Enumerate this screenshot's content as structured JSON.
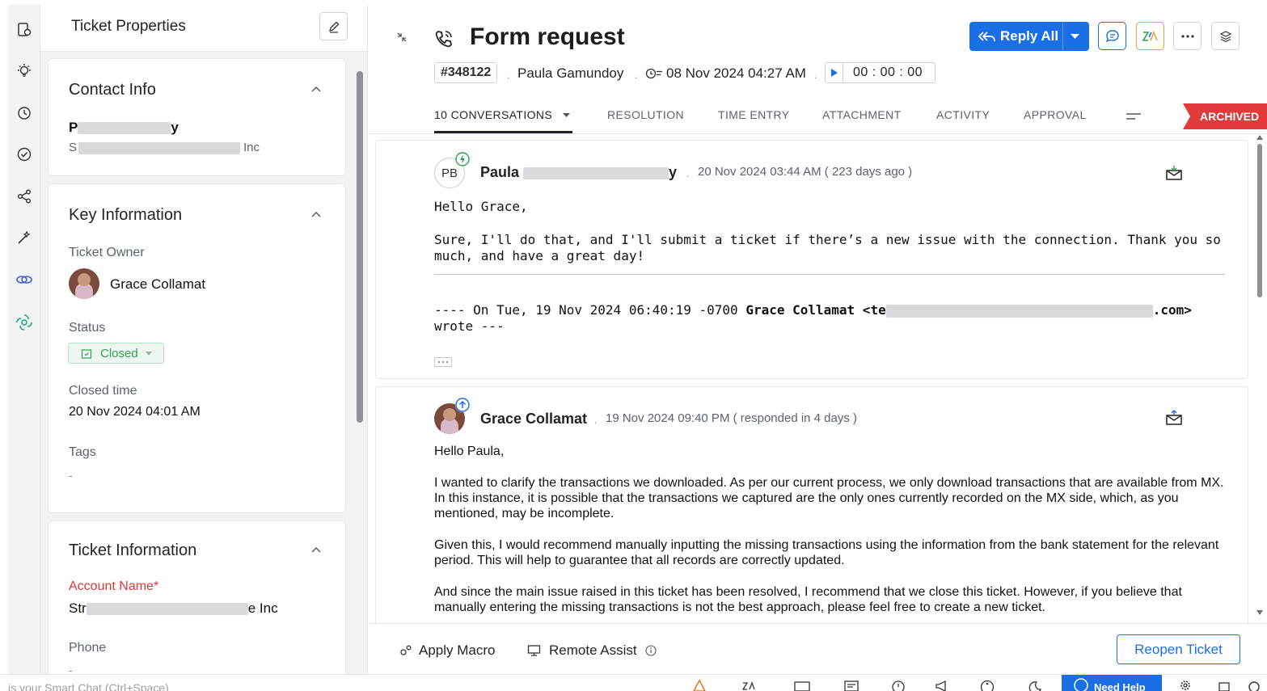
{
  "panel": {
    "title": "Ticket Properties"
  },
  "contact": {
    "section_title": "Contact Info",
    "name_start": "P",
    "name_end": "y",
    "account_start": "S",
    "account_end": "Inc"
  },
  "key_info": {
    "section_title": "Key Information",
    "owner_label": "Ticket Owner",
    "owner_name": "Grace Collamat",
    "status_label": "Status",
    "status_value": "Closed",
    "closed_time_label": "Closed time",
    "closed_time_value": "20 Nov 2024 04:01 AM",
    "tags_label": "Tags",
    "tags_value": "-"
  },
  "ticket_info": {
    "section_title": "Ticket Information",
    "account_label": "Account Name",
    "required_mark": "*",
    "account_start": "Str",
    "account_end": "e Inc",
    "phone_label": "Phone",
    "phone_value": "-"
  },
  "header": {
    "title": "Form request",
    "ticket_number": "#348122",
    "contact_name": "Paula Gamundoy",
    "due_time": "08 Nov 2024 04:27 AM",
    "timer": "00 : 00 : 00",
    "reply_all_label": "Reply All"
  },
  "tabs": [
    {
      "label": "10 CONVERSATIONS"
    },
    {
      "label": "RESOLUTION"
    },
    {
      "label": "TIME ENTRY"
    },
    {
      "label": "ATTACHMENT"
    },
    {
      "label": "ACTIVITY"
    },
    {
      "label": "APPROVAL"
    }
  ],
  "archived_label": "ARCHIVED",
  "threads": [
    {
      "avatar_initials": "PB",
      "sender_start": "Paula",
      "sender_end": "y",
      "timestamp": "20 Nov 2024 03:44 AM",
      "relative": "( 223 days ago )",
      "greeting": "Hello Grace,",
      "body": "Sure, I'll do that, and I'll submit a ticket if there’s a new issue with the connection. Thank you so much, and have a great day!",
      "quote_prefix": "---- On Tue, 19 Nov 2024 06:40:19 -0700 ",
      "quote_name": "Grace Collamat <te",
      "quote_domain": ".com>",
      "quote_suffix": "wrote ---"
    },
    {
      "sender": "Grace Collamat",
      "timestamp": "19 Nov 2024 09:40 PM",
      "relative": "( responded in 4 days )",
      "greeting": "Hello Paula,",
      "p1": "I wanted to clarify the transactions we downloaded. As per our current process, we only download transactions that are available from MX. In this instance, it is possible that the transactions we captured are the only ones currently recorded on the MX side, which, as you mentioned, may be incomplete.",
      "p2": "Given this, I would recommend manually inputting the missing transactions using the information from the bank statement for the relevant period. This will help to guarantee that all records are correctly updated.",
      "p3": "And since the main issue raised in this ticket has been resolved, I recommend that we close this ticket. However, if you believe that manually entering the missing transactions is not the best approach, please feel free to create a new ticket."
    }
  ],
  "actions": {
    "apply_macro": "Apply Macro",
    "remote_assist": "Remote Assist",
    "reopen": "Reopen Ticket"
  },
  "statusbar": {
    "chat_hint": "is your Smart Chat (Ctrl+Space)",
    "need_help": "Need Help"
  },
  "colors": {
    "primary": "#1b6fe6",
    "archived": "#e03a3a",
    "status_closed": "#2e9e4f",
    "required": "#d93838"
  }
}
